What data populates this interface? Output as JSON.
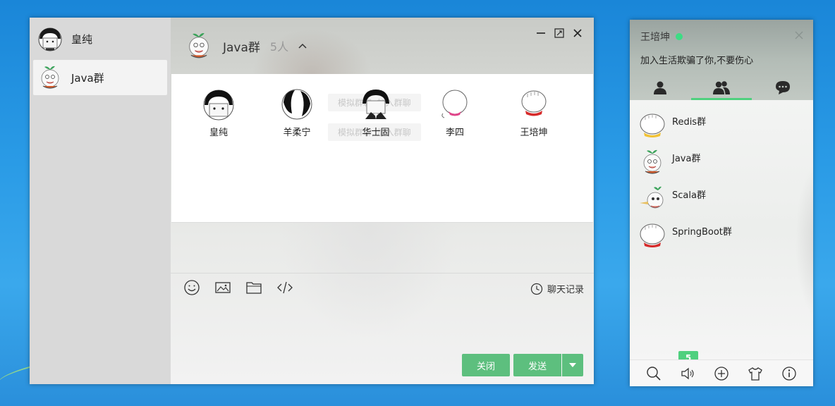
{
  "chat_list": {
    "items": [
      {
        "name": "皇纯",
        "avatar": "black-hair-avatar",
        "active": false
      },
      {
        "name": "Java群",
        "avatar": "sprout-cartoon-avatar",
        "active": true
      }
    ]
  },
  "chat": {
    "title": "Java群",
    "member_count": "5人",
    "members": [
      {
        "name": "皇纯",
        "avatar": "black-hair-avatar"
      },
      {
        "name": "羊柔宁",
        "avatar": "panda-avatar"
      },
      {
        "name": "华士固",
        "avatar": "suit-avatar"
      },
      {
        "name": "李四",
        "avatar": "bald-pink-avatar"
      },
      {
        "name": "王培坤",
        "avatar": "bald-red-avatar"
      }
    ],
    "ghost_hints": [
      "模拟群聊, 加入群聊",
      "模拟群聊, 加入群聊"
    ],
    "history_label": "聊天记录",
    "close_label": "关闭",
    "send_label": "发送"
  },
  "main_panel": {
    "user_name": "王培坤",
    "signature": "加入生活欺骗了你,不要伤心",
    "status_color": "#3ddc84",
    "groups": [
      {
        "name": "Redis群",
        "avatar": "yellow-collar-avatar"
      },
      {
        "name": "Java群",
        "avatar": "sprout-cartoon-avatar"
      },
      {
        "name": "Scala群",
        "avatar": "scala-cartoon-avatar"
      },
      {
        "name": "SpringBoot群",
        "avatar": "red-collar-avatar"
      }
    ],
    "badge_count": "5"
  },
  "colors": {
    "accent": "#5dbf7e",
    "tab_indicator": "#4fd07e"
  }
}
